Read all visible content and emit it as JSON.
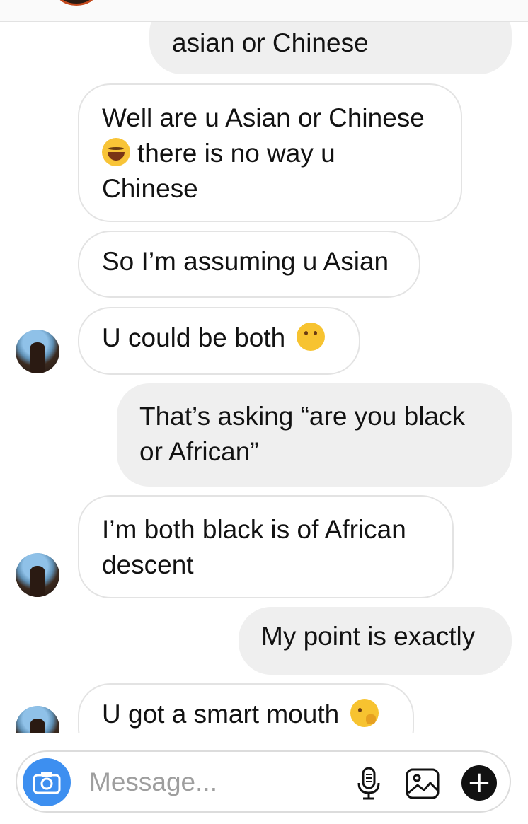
{
  "messages": [
    {
      "id": 0,
      "direction": "outgoing",
      "text": "asian or Chinese"
    },
    {
      "id": 1,
      "direction": "incoming",
      "text_a": "Well are u Asian or Chinese",
      "emoji": "face-with-tears-of-joy",
      "text_b": "there is no way u Chinese"
    },
    {
      "id": 2,
      "direction": "incoming",
      "text": "So I’m assuming u Asian"
    },
    {
      "id": 3,
      "direction": "incoming",
      "text": "U could be both",
      "emoji": "thinking-face"
    },
    {
      "id": 4,
      "direction": "outgoing",
      "text": "That’s asking “are you black or African”"
    },
    {
      "id": 5,
      "direction": "incoming",
      "text": "I’m both black is of African descent"
    },
    {
      "id": 6,
      "direction": "outgoing",
      "text": "My point is exactly"
    },
    {
      "id": 7,
      "direction": "incoming",
      "text": "U got a smart mouth",
      "emoji": "face-with-hand-over-mouth"
    }
  ],
  "composer": {
    "placeholder": "Message...",
    "icons": [
      "camera-icon",
      "microphone-icon",
      "gallery-icon",
      "plus-icon"
    ]
  },
  "colors": {
    "outgoing_bubble": "#efefef",
    "incoming_border": "#e3e3e3",
    "camera_button": "#3d8ff0",
    "placeholder_text": "#9e9e9e"
  }
}
